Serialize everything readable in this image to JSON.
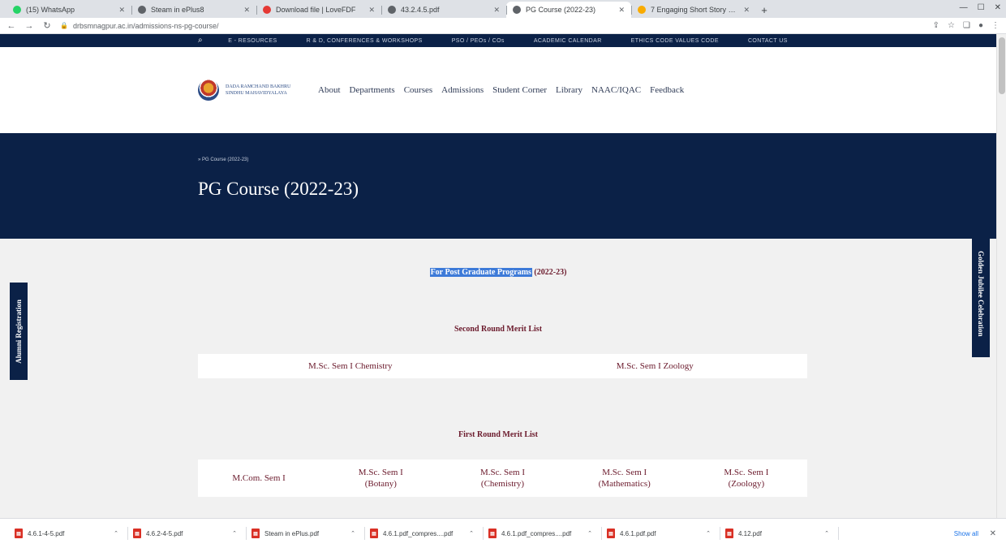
{
  "browser": {
    "tabs": [
      {
        "title": "(15) WhatsApp",
        "color": "#25d366",
        "active": false
      },
      {
        "title": "Steam in ePlus8",
        "color": "#5f6368",
        "active": false
      },
      {
        "title": "Download file | LoveFDF",
        "color": "#e53935",
        "active": false
      },
      {
        "title": "43.2.4.5.pdf",
        "color": "#5f6368",
        "active": false
      },
      {
        "title": "PG Course (2022-23)",
        "color": "#5f6368",
        "active": true
      },
      {
        "title": "7 Engaging Short Story Collecti...",
        "color": "#f9ab00",
        "active": false
      }
    ],
    "url": "drbsmnagpur.ac.in/admissions-ns-pg-course/"
  },
  "site": {
    "topbar_links": [
      "E - RESOURCES",
      "R & D, CONFERENCES & WORKSHOPS",
      "PSO / PEOs / COs",
      "ACADEMIC CALENDAR",
      "ETHICS CODE VALUES CODE",
      "CONTACT US"
    ],
    "logo_text": "DADA RAMCHAND BAKHRU SINDHU MAHAVIDYALAYA",
    "nav": [
      "About",
      "Departments",
      "Courses",
      "Admissions",
      "Student Corner",
      "Library",
      "NAAC/IQAC",
      "Feedback"
    ],
    "breadcrumb": "» PG Course (2022-23)",
    "page_title": "PG Course (2022-23)",
    "subtitle_highlight": "For Post Graduate Programs",
    "subtitle_rest": " (2022-23)",
    "second_round": {
      "title": "Second Round Merit List",
      "items": [
        "M.Sc. Sem I Chemistry",
        "M.Sc. Sem I Zoology"
      ]
    },
    "first_round": {
      "title": "First Round Merit List",
      "items": [
        {
          "l1": "M.Com. Sem I",
          "l2": ""
        },
        {
          "l1": "M.Sc. Sem I",
          "l2": "(Botany)"
        },
        {
          "l1": "M.Sc. Sem I",
          "l2": "(Chemistry)"
        },
        {
          "l1": "M.Sc. Sem I",
          "l2": "(Mathematics)"
        },
        {
          "l1": "M.Sc. Sem I",
          "l2": "(Zoology)"
        }
      ]
    },
    "side_left": "Alumni Registration",
    "side_right": "Golden Jubilee Celebration"
  },
  "downloads": {
    "items": [
      "4.6.1-4-5.pdf",
      "4.6.2-4-5.pdf",
      "Steam in ePlus.pdf",
      "4.6.1.pdf_compres....pdf",
      "4.6.1.pdf_compres....pdf",
      "4.6.1.pdf.pdf",
      "4.12.pdf"
    ],
    "show_all": "Show all"
  }
}
